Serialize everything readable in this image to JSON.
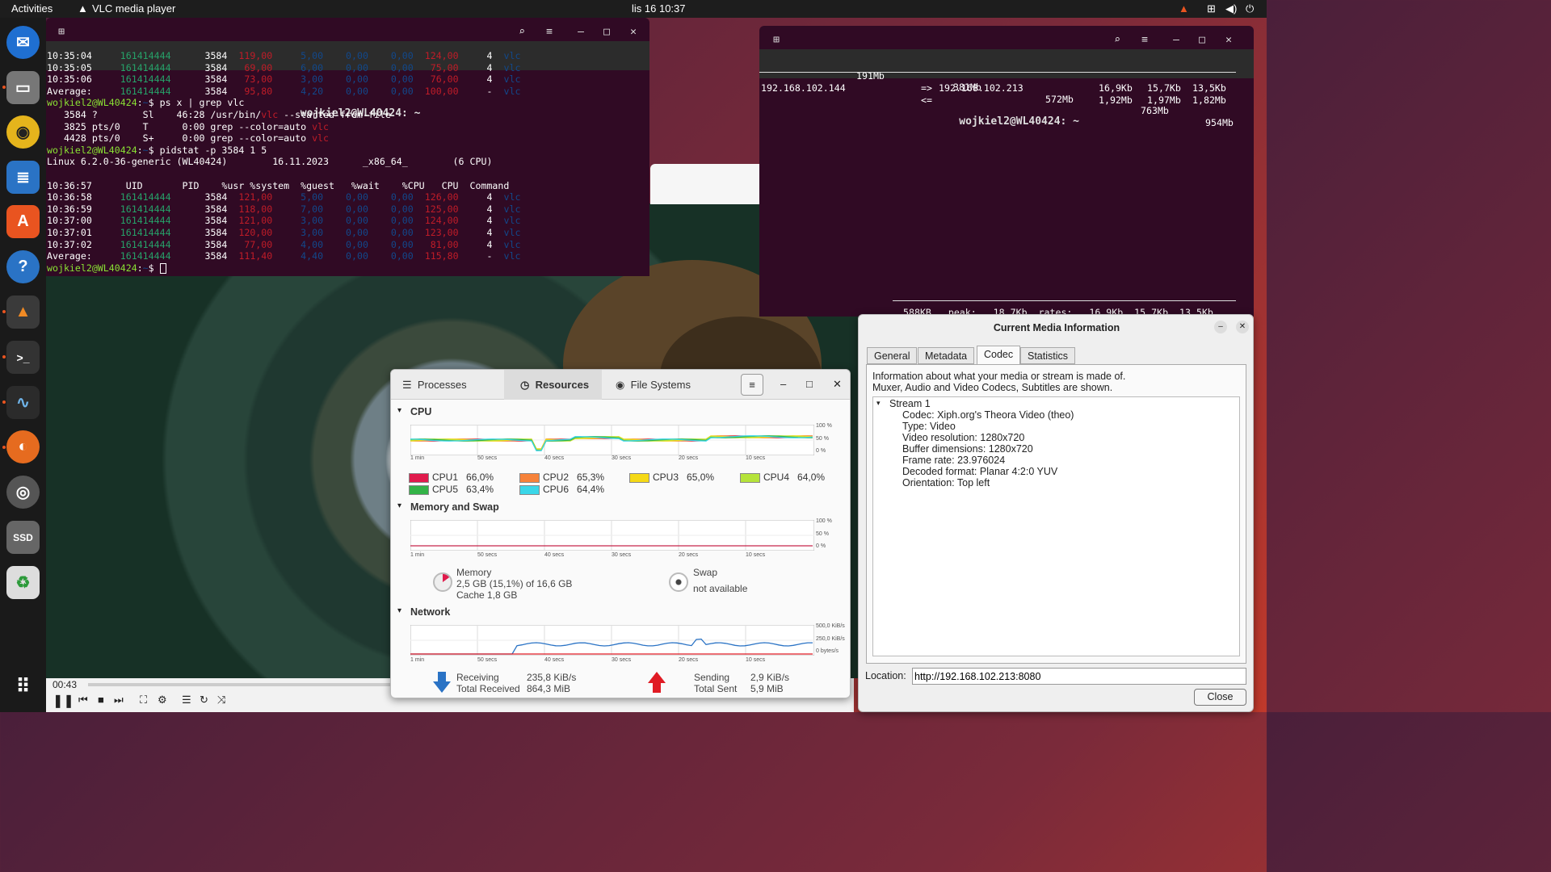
{
  "topbar": {
    "activities": "Activities",
    "app": "VLC media player",
    "clock": "lis 16  10:37"
  },
  "dock": [
    "thunderbird-icon",
    "files-icon",
    "rhythmbox-icon",
    "writer-icon",
    "app-center-icon",
    "help-icon",
    "vlc-icon",
    "terminal-icon",
    "system-monitor-icon",
    "firefox-icon",
    "disks-icon",
    "ssd-icon",
    "trash-icon",
    "apps-grid-icon"
  ],
  "terminal1": {
    "title": "wojkiel2@WL40424: ~",
    "rows_top": [
      {
        "t": "10:35:04",
        "uid": "161414444",
        "pid": "3584",
        "usr": "119,00",
        "sys": "5,00",
        "guest": "0,00",
        "wait": "0,00",
        "cpu": "124,00",
        "cpun": "4",
        "cmd": "vlc"
      },
      {
        "t": "10:35:05",
        "uid": "161414444",
        "pid": "3584",
        "usr": "69,00",
        "sys": "6,00",
        "guest": "0,00",
        "wait": "0,00",
        "cpu": "75,00",
        "cpun": "4",
        "cmd": "vlc"
      },
      {
        "t": "10:35:06",
        "uid": "161414444",
        "pid": "3584",
        "usr": "73,00",
        "sys": "3,00",
        "guest": "0,00",
        "wait": "0,00",
        "cpu": "76,00",
        "cpun": "4",
        "cmd": "vlc"
      },
      {
        "t": "Average:",
        "uid": "161414444",
        "pid": "3584",
        "usr": "95,80",
        "sys": "4,20",
        "guest": "0,00",
        "wait": "0,00",
        "cpu": "100,00",
        "cpun": "-",
        "cmd": "vlc"
      }
    ],
    "prompt": "wojkiel2@WL40424",
    "cmd1": "$ ps x | grep vlc",
    "ps_lines": [
      [
        "   3584 ?        Sl    46:28 /usr/bin/",
        "vlc",
        " --started-from-file",
        ""
      ],
      [
        "   3825 pts/0    T      0:00 grep --color=auto ",
        "vlc",
        "",
        ""
      ],
      [
        "   4428 pts/0    S+     0:00 grep --color=auto ",
        "vlc",
        "",
        ""
      ]
    ],
    "cmd2": "$ pidstat -p 3584 1 5",
    "sysline": "Linux 6.2.0-36-generic (WL40424)        16.11.2023      _x86_64_        (6 CPU)",
    "header": "10:36:57      UID       PID    %usr %system  %guest   %wait    %CPU   CPU  Command",
    "rows_bottom": [
      {
        "t": "10:36:58",
        "uid": "161414444",
        "pid": "3584",
        "usr": "121,00",
        "sys": "5,00",
        "guest": "0,00",
        "wait": "0,00",
        "cpu": "126,00",
        "cpun": "4",
        "cmd": "vlc"
      },
      {
        "t": "10:36:59",
        "uid": "161414444",
        "pid": "3584",
        "usr": "118,00",
        "sys": "7,00",
        "guest": "0,00",
        "wait": "0,00",
        "cpu": "125,00",
        "cpun": "4",
        "cmd": "vlc"
      },
      {
        "t": "10:37:00",
        "uid": "161414444",
        "pid": "3584",
        "usr": "121,00",
        "sys": "3,00",
        "guest": "0,00",
        "wait": "0,00",
        "cpu": "124,00",
        "cpun": "4",
        "cmd": "vlc"
      },
      {
        "t": "10:37:01",
        "uid": "161414444",
        "pid": "3584",
        "usr": "120,00",
        "sys": "3,00",
        "guest": "0,00",
        "wait": "0,00",
        "cpu": "123,00",
        "cpun": "4",
        "cmd": "vlc"
      },
      {
        "t": "10:37:02",
        "uid": "161414444",
        "pid": "3584",
        "usr": "77,00",
        "sys": "4,00",
        "guest": "0,00",
        "wait": "0,00",
        "cpu": "81,00",
        "cpun": "4",
        "cmd": "vlc"
      },
      {
        "t": "Average:",
        "uid": "161414444",
        "pid": "3584",
        "usr": "111,40",
        "sys": "4,40",
        "guest": "0,00",
        "wait": "0,00",
        "cpu": "115,80",
        "cpun": "-",
        "cmd": "vlc"
      }
    ],
    "final_prompt": "$ "
  },
  "terminal2": {
    "title": "wojkiel2@WL40424: ~",
    "scale": [
      "191Mb",
      "381Mb",
      "572Mb",
      "763Mb",
      "954Mb"
    ],
    "src": "192.168.102.144",
    "dir_out": "=>",
    "dst": "192.168.102.213",
    "out": [
      "16,9Kb",
      "15,7Kb",
      "13,5Kb"
    ],
    "dir_in": "<=",
    "in": [
      "1,92Mb",
      "1,97Mb",
      "1,82Mb"
    ],
    "footer": "588KB   peak:   18,7Kb  rates:   16,9Kb  15,7Kb  13,5Kb"
  },
  "vlc": {
    "time": "00:43"
  },
  "sysmon": {
    "tabs": [
      "Processes",
      "Resources",
      "File Systems"
    ],
    "active_tab": "Resources",
    "cpu_title": "CPU",
    "mem_title": "Memory and Swap",
    "net_title": "Network",
    "x_ticks": [
      "1 min",
      "50 secs",
      "40 secs",
      "30 secs",
      "20 secs",
      "10 secs"
    ],
    "pct_ticks": [
      "100 %",
      "50 %",
      "0 %"
    ],
    "net_ticks": [
      "500,0 KiB/s",
      "250,0 KiB/s",
      "0 bytes/s"
    ],
    "cpus": [
      {
        "name": "CPU1",
        "value": "66,0%",
        "color": "#e01b4c"
      },
      {
        "name": "CPU2",
        "value": "65,3%",
        "color": "#f6823a"
      },
      {
        "name": "CPU3",
        "value": "65,0%",
        "color": "#f5d916"
      },
      {
        "name": "CPU4",
        "value": "64,0%",
        "color": "#b5e33a"
      },
      {
        "name": "CPU5",
        "value": "63,4%",
        "color": "#33b347"
      },
      {
        "name": "CPU6",
        "value": "64,4%",
        "color": "#3ad6e8"
      }
    ],
    "memory_label": "Memory",
    "memory_value": "2,5 GB (15,1%) of 16,6 GB",
    "cache": "Cache 1,8 GB",
    "swap_label": "Swap",
    "swap_value": "not available",
    "recv_label": "Receiving",
    "recv_value": "235,8 KiB/s",
    "total_recv_label": "Total Received",
    "total_recv_value": "864,3 MiB",
    "send_label": "Sending",
    "send_value": "2,9 KiB/s",
    "total_sent_label": "Total Sent",
    "total_sent_value": "5,9 MiB"
  },
  "codec": {
    "title": "Current Media Information",
    "tabs": [
      "General",
      "Metadata",
      "Codec",
      "Statistics"
    ],
    "active_tab": "Codec",
    "desc1": "Information about what your media or stream is made of.",
    "desc2": "Muxer, Audio and Video Codecs, Subtitles are shown.",
    "stream": "Stream 1",
    "props": [
      "Codec: Xiph.org's Theora Video (theo)",
      "Type: Video",
      "Video resolution: 1280x720",
      "Buffer dimensions: 1280x720",
      "Frame rate: 23.976024",
      "Decoded format: Planar 4:2:0 YUV",
      "Orientation: Top left"
    ],
    "location_label": "Location:",
    "location_value": "http://192.168.102.213:8080",
    "close": "Close"
  }
}
